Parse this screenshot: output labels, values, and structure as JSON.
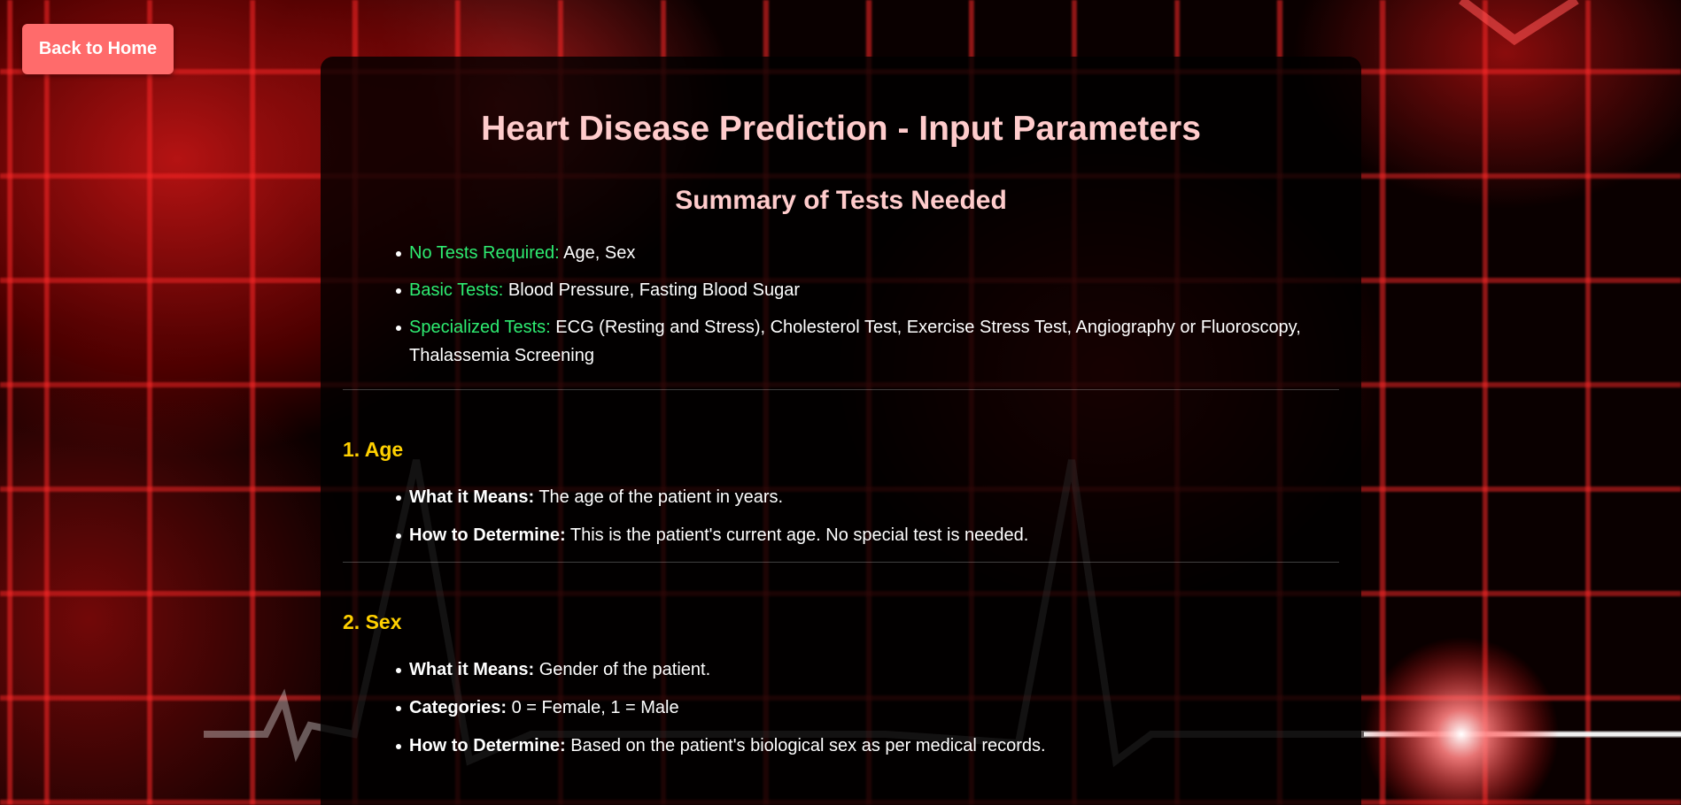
{
  "nav": {
    "back_label": "Back to Home"
  },
  "page": {
    "title": "Heart Disease Prediction - Input Parameters",
    "summary_title": "Summary of Tests Needed"
  },
  "summary": [
    {
      "label": "No Tests Required:",
      "value": "Age, Sex"
    },
    {
      "label": "Basic Tests:",
      "value": "Blood Pressure, Fasting Blood Sugar"
    },
    {
      "label": "Specialized Tests:",
      "value": "ECG (Resting and Stress), Cholesterol Test, Exercise Stress Test, Angiography or Fluoroscopy, Thalassemia Screening"
    }
  ],
  "sections": [
    {
      "title": "1. Age",
      "items": [
        {
          "label": "What it Means:",
          "value": "The age of the patient in years."
        },
        {
          "label": "How to Determine:",
          "value": "This is the patient's current age. No special test is needed."
        }
      ]
    },
    {
      "title": "2. Sex",
      "items": [
        {
          "label": "What it Means:",
          "value": "Gender of the patient."
        },
        {
          "label": "Categories:",
          "value": "0 = Female, 1 = Male"
        },
        {
          "label": "How to Determine:",
          "value": "Based on the patient's biological sex as per medical records."
        }
      ]
    }
  ],
  "colors": {
    "accent_button": "#ff6b6b",
    "heading": "#ffcccc",
    "summary_label": "#2eec71",
    "section_title": "#ffd000"
  }
}
